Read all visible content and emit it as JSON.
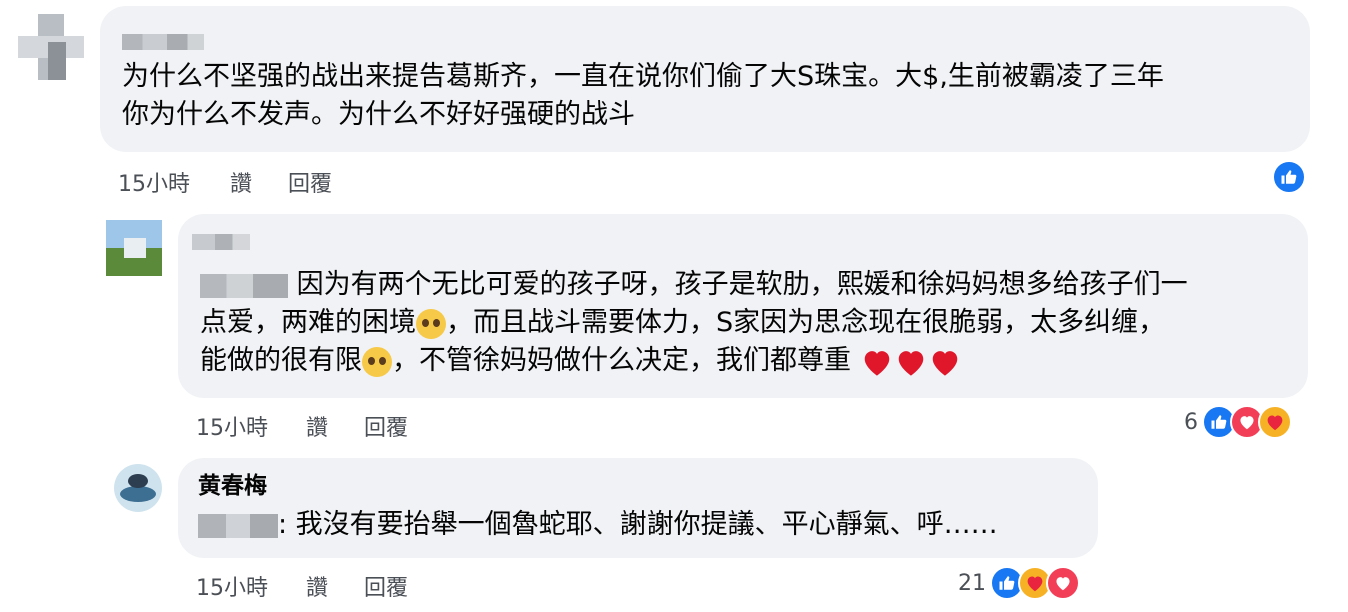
{
  "comments": [
    {
      "text_lines": [
        "为什么不坚强的战出来提告葛斯齐，一直在说你们偷了大S珠宝。大$,生前被霸凌了三年",
        "你为什么不发声。为什么不好好强硬的战斗"
      ],
      "time": "15小時",
      "like_label": "讚",
      "reply_label": "回覆",
      "reaction_count": "",
      "reactions": [
        "like-icon"
      ]
    },
    {
      "text_line1": "因为有两个无比可爱的孩子呀，孩子是软肋，熙媛和徐妈妈想多给孩子们一",
      "text_line2_a": "点爱，两难的困境",
      "text_line2_b": "，而且战斗需要体力，S家因为思念现在很脆弱，太多纠缠，",
      "text_line3_a": "能做的很有限",
      "text_line3_b": "，不管徐妈妈做什么决定，我们都尊重",
      "time": "15小時",
      "like_label": "讚",
      "reply_label": "回覆",
      "reaction_count": "6",
      "reactions": [
        "like-icon",
        "love-icon",
        "care-icon"
      ]
    },
    {
      "author": "黄春梅",
      "text": ": 我沒有要抬舉一個魯蛇耶、謝謝你提議、平心靜氣、呼……",
      "time": "15小時",
      "like_label": "讚",
      "reply_label": "回覆",
      "reaction_count": "21",
      "reactions": [
        "like-icon",
        "care-icon",
        "love-icon"
      ]
    }
  ],
  "colors": {
    "bubble": "#f0f2f5",
    "like_blue": "#1877f2",
    "love_red": "#f33e58",
    "care_yellow": "#f7b125",
    "meta_gray": "#4b4f56"
  }
}
